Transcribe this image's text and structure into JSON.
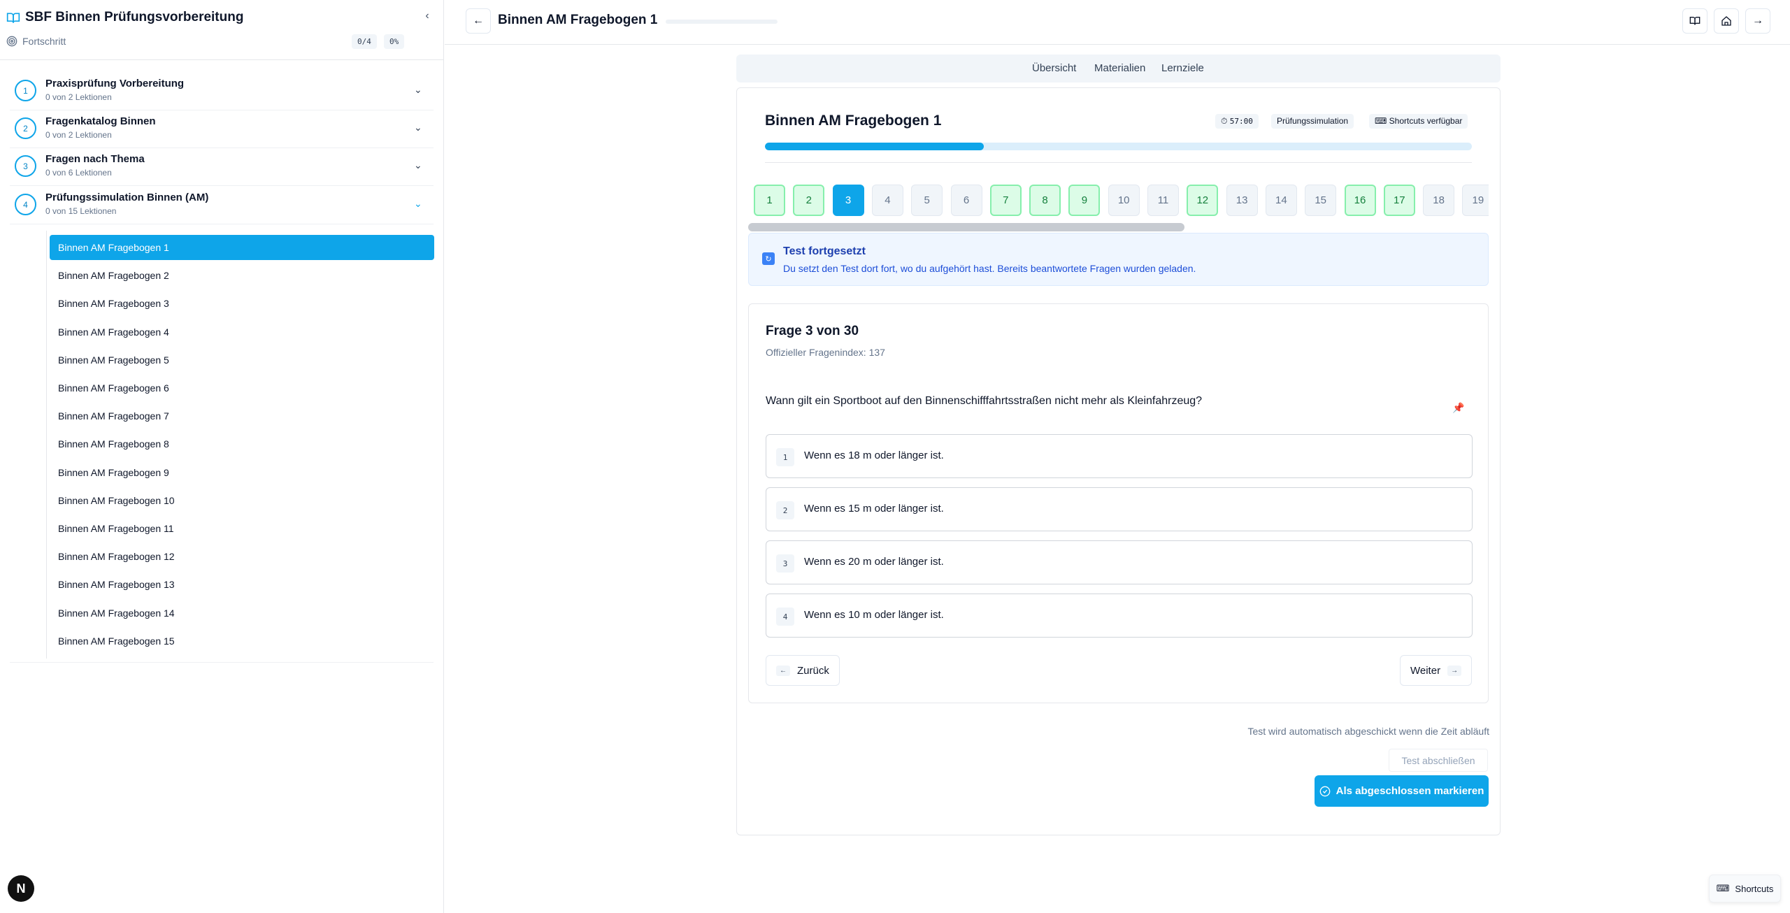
{
  "sidebar": {
    "title": "SBF Binnen Prüfungsvorbereitung",
    "progress_label": "Fortschritt",
    "progress_count": "0/4",
    "progress_percent": "0%",
    "modules": [
      {
        "num": "1",
        "title": "Praxisprüfung Vorbereitung",
        "sub": "0 von 2 Lektionen"
      },
      {
        "num": "2",
        "title": "Fragenkatalog Binnen",
        "sub": "0 von 2 Lektionen"
      },
      {
        "num": "3",
        "title": "Fragen nach Thema",
        "sub": "0 von 6 Lektionen"
      },
      {
        "num": "4",
        "title": "Prüfungssimulation Binnen (AM)",
        "sub": "0 von 15 Lektionen"
      }
    ],
    "lessons": [
      "Binnen AM Fragebogen 1",
      "Binnen AM Fragebogen 2",
      "Binnen AM Fragebogen 3",
      "Binnen AM Fragebogen 4",
      "Binnen AM Fragebogen 5",
      "Binnen AM Fragebogen 6",
      "Binnen AM Fragebogen 7",
      "Binnen AM Fragebogen 8",
      "Binnen AM Fragebogen 9",
      "Binnen AM Fragebogen 10",
      "Binnen AM Fragebogen 11",
      "Binnen AM Fragebogen 12",
      "Binnen AM Fragebogen 13",
      "Binnen AM Fragebogen 14",
      "Binnen AM Fragebogen 15"
    ],
    "badge": "N"
  },
  "topbar": {
    "title": "Binnen AM Fragebogen 1"
  },
  "tabs": [
    "Übersicht",
    "Materialien",
    "Lernziele"
  ],
  "quiz": {
    "title": "Binnen AM Fragebogen 1",
    "timer": "57:00",
    "mode_chip": "Prüfungssimulation",
    "shortcuts_chip": "Shortcuts verfügbar",
    "progress_fraction": 0.31,
    "questions": [
      {
        "n": "1",
        "state": "answered"
      },
      {
        "n": "2",
        "state": "answered"
      },
      {
        "n": "3",
        "state": "current"
      },
      {
        "n": "4",
        "state": "open"
      },
      {
        "n": "5",
        "state": "open"
      },
      {
        "n": "6",
        "state": "open"
      },
      {
        "n": "7",
        "state": "answered"
      },
      {
        "n": "8",
        "state": "answered"
      },
      {
        "n": "9",
        "state": "answered"
      },
      {
        "n": "10",
        "state": "open"
      },
      {
        "n": "11",
        "state": "open"
      },
      {
        "n": "12",
        "state": "answered"
      },
      {
        "n": "13",
        "state": "open"
      },
      {
        "n": "14",
        "state": "open"
      },
      {
        "n": "15",
        "state": "open"
      },
      {
        "n": "16",
        "state": "answered"
      },
      {
        "n": "17",
        "state": "answered"
      },
      {
        "n": "18",
        "state": "open"
      },
      {
        "n": "19",
        "state": "open"
      }
    ],
    "notice": {
      "title": "Test fortgesetzt",
      "text": "Du setzt den Test dort fort, wo du aufgehört hast. Bereits beantwortete Fragen wurden geladen."
    },
    "question": {
      "heading": "Frage 3 von 30",
      "index": "Offizieller Fragenindex: 137",
      "text": "Wann gilt ein Sportboot auf den Binnenschifffahrtsstraßen nicht mehr als Kleinfahrzeug?",
      "answers": [
        {
          "num": "1",
          "text": "Wenn es 18 m oder länger ist."
        },
        {
          "num": "2",
          "text": "Wenn es 15 m oder länger ist."
        },
        {
          "num": "3",
          "text": "Wenn es 20 m oder länger ist."
        },
        {
          "num": "4",
          "text": "Wenn es 10 m oder länger ist."
        }
      ],
      "back_label": "Zurück",
      "next_label": "Weiter"
    },
    "auto_note": "Test wird automatisch abgeschickt wenn die Zeit abläuft",
    "finish_label": "Test abschließen",
    "complete_label": "Als abgeschlossen markieren"
  },
  "shortcuts_label": "Shortcuts",
  "icons": {
    "sidebar_logo": "book-open-icon",
    "collapse": "chevron-left-icon",
    "progress": "target-icon",
    "back": "arrow-left-icon",
    "book": "book-icon",
    "home": "home-icon",
    "forward": "arrow-right-icon",
    "pin": "pin-icon",
    "timer": "stopwatch-icon",
    "keyboard": "keyboard-icon"
  }
}
